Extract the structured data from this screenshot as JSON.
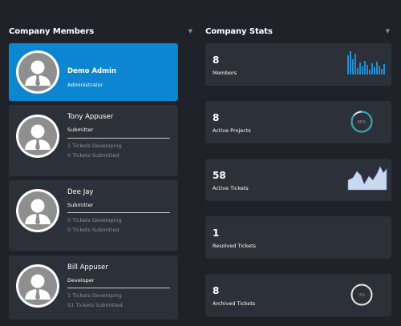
{
  "members_panel": {
    "title": "Company Members",
    "members": [
      {
        "name": "Demo Admin",
        "role": "Administrator"
      },
      {
        "name": "Tony Appuser",
        "role": "Submitter",
        "developing": "1 Tickets Developing",
        "submitted": "0 Tickets Submitted"
      },
      {
        "name": "Dee Jay",
        "role": "Submitter",
        "developing": "0 Tickets Developing",
        "submitted": "0 Tickets Submitted"
      },
      {
        "name": "Bill Appuser",
        "role": "Developer",
        "developing": "1 Tickets Developing",
        "submitted": "51 Tickets Submitted"
      }
    ]
  },
  "stats_panel": {
    "title": "Company Stats",
    "stats": [
      {
        "value": "8",
        "label": "Members"
      },
      {
        "value": "8",
        "label": "Active Projects",
        "donut_text": "85%"
      },
      {
        "value": "58",
        "label": "Active Tickets"
      },
      {
        "value": "1",
        "label": "Resolved Tickets"
      },
      {
        "value": "8",
        "label": "Archived Tickets",
        "donut_text": "0%"
      }
    ]
  },
  "colors": {
    "background": "#1f2228",
    "card": "#2c3038",
    "active_card": "#0d86d1",
    "accent": "#1c8fd6",
    "area_fill": "#c7d8f0"
  },
  "icons": {
    "avatar": "person-silhouette-icon",
    "dropdown": "caret-down-icon"
  }
}
